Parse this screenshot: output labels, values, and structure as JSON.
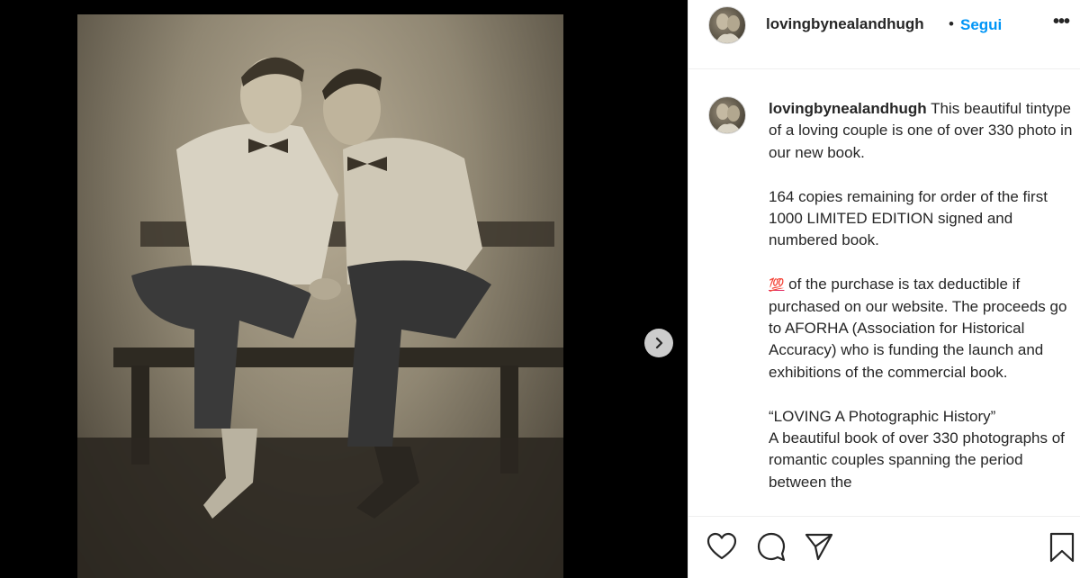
{
  "post": {
    "username": "lovingbynealandhugh",
    "separator": "•",
    "follow_label": "Segui",
    "more_label": "•••"
  },
  "caption": {
    "username": "lovingbynealandhugh",
    "intro": "This beautiful tintype of a loving couple is one of over 330 photo in our new book.",
    "p2": "164 copies remaining for order of the first 1000 LIMITED EDITION signed and numbered book.",
    "p3_emoji": "💯",
    "p3": "of the purchase is tax deductible if purchased on our website. The proceeds go to AFORHA (Association for Historical Accuracy) who is funding the launch and exhibitions of the commercial book.",
    "p4_line1": "“LOVING A Photographic History”",
    "p4_rest": "A beautiful book of over 330 photographs of romantic couples spanning the period between the"
  },
  "icons": {
    "like": "heart-icon",
    "comment": "comment-icon",
    "share": "paper-plane-icon",
    "save": "bookmark-icon",
    "next": "chevron-right-icon"
  },
  "colors": {
    "link_blue": "#0095f6",
    "text": "#262626",
    "divider": "#efefef"
  }
}
